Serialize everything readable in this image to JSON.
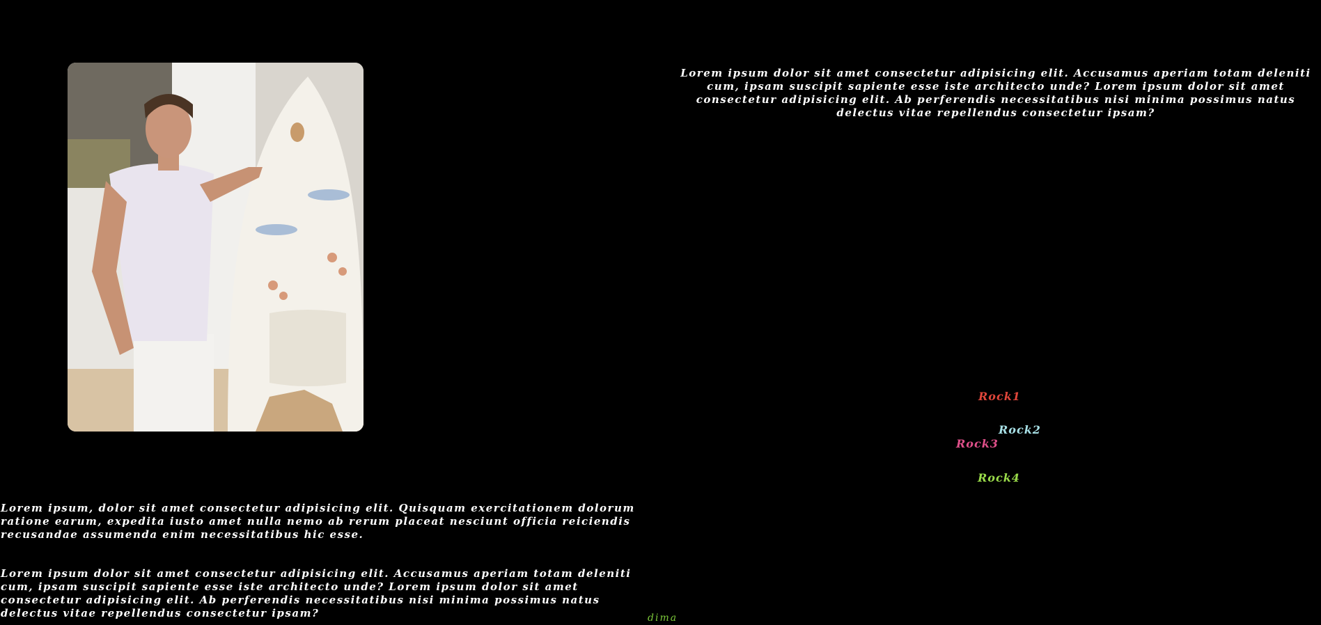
{
  "top_text": "Lorem ipsum dolor sit amet consectetur adipisicing elit. Accusamus aperiam totam deleniti cum, ipsam suscipit sapiente esse iste architecto unde? Lorem ipsum dolor sit amet consectetur adipisicing elit. Ab perferendis necessitatibus nisi minima possimus natus delectus vitae repellendus consectetur ipsam?",
  "left_text_1": "Lorem ipsum, dolor sit amet consectetur adipisicing elit. Quisquam exercitationem dolorum ratione earum, expedita iusto amet nulla nemo ab rerum placeat nesciunt officia reiciendis recusandae assumenda enim necessitatibus hic esse.",
  "left_text_2": "Lorem ipsum dolor sit amet consectetur adipisicing elit. Accusamus aperiam totam deleniti cum, ipsam suscipit sapiente esse iste architecto unde? Lorem ipsum dolor sit amet consectetur adipisicing elit. Ab perferendis necessitatibus nisi minima possimus natus delectus vitae repellendus consectetur ipsam?",
  "rocks": [
    {
      "label": "Rock1",
      "color": "#e0463a"
    },
    {
      "label": "Rock2",
      "color": "#a8e0e6"
    },
    {
      "label": "Rock3",
      "color": "#e0508a"
    },
    {
      "label": "Rock4",
      "color": "#9adb4a"
    }
  ],
  "footer": {
    "label": "dima",
    "color": "#7cc83a"
  },
  "colors": {
    "background": "#000000",
    "text": "#ffffff"
  }
}
